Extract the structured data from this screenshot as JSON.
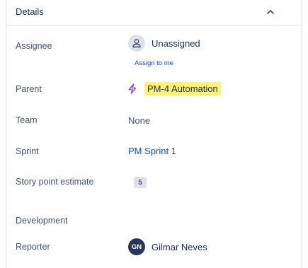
{
  "details": {
    "title": "Details",
    "collapse_icon": "chevron-up-icon"
  },
  "fields": {
    "assignee": {
      "label": "Assignee",
      "value": "Unassigned",
      "icon": "person-icon",
      "assign_link": "Assign to me"
    },
    "parent": {
      "label": "Parent",
      "value": "PM-4 Automation",
      "icon": "lightning-bolt-icon",
      "highlight_color": "#fff27a",
      "icon_color": "#904ee2"
    },
    "team": {
      "label": "Team",
      "value": "None"
    },
    "sprint": {
      "label": "Sprint",
      "value": "PM Sprint 1",
      "link_color": "#0052cc"
    },
    "story_points": {
      "label": "Story point estimate",
      "value": "5"
    },
    "development": {
      "label": "Development"
    },
    "reporter": {
      "label": "Reporter",
      "initials": "GN",
      "name": "Gilmar Neves"
    }
  }
}
